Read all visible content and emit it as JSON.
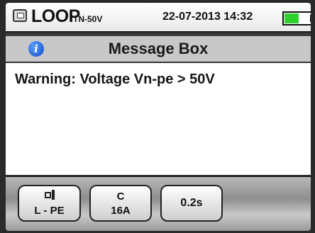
{
  "status": {
    "mode": "LOOP",
    "submode": "TN-50V",
    "datetime": "22-07-2013 14:32",
    "battery_level": 0.55
  },
  "message_box": {
    "title": "Message Box",
    "text": "Warning: Voltage Vn-pe > 50V"
  },
  "softkeys": [
    {
      "icon": "plug-icon",
      "label": "L - PE"
    },
    {
      "top": "C",
      "bottom": "16A"
    },
    {
      "label": "0.2s"
    }
  ],
  "colors": {
    "battery": "#2fd12f",
    "info_icon": "#1047c9"
  }
}
